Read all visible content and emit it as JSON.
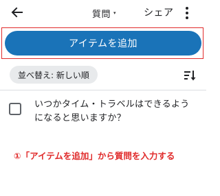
{
  "topbar": {
    "back_icon": "arrow-left-icon",
    "title": "質問",
    "title_caret": "▾",
    "share_label": "シェア",
    "more_icon": "more-vert-icon"
  },
  "actions": {
    "add_item_label": "アイテムを追加"
  },
  "sort": {
    "chip_label": "並べ替え: 新しい順",
    "sort_icon": "sort-icon"
  },
  "items": [
    {
      "text": "いつかタイム・トラベルはできるようになると思いますか？",
      "checked": false
    }
  ],
  "annotation": {
    "text": "①「アイテムを追加」から質問を入力する",
    "color": "#e02a2a"
  },
  "colors": {
    "accent": "#1a73b8",
    "highlight": "#e02a2a",
    "chip_bg": "#e8eaec"
  }
}
